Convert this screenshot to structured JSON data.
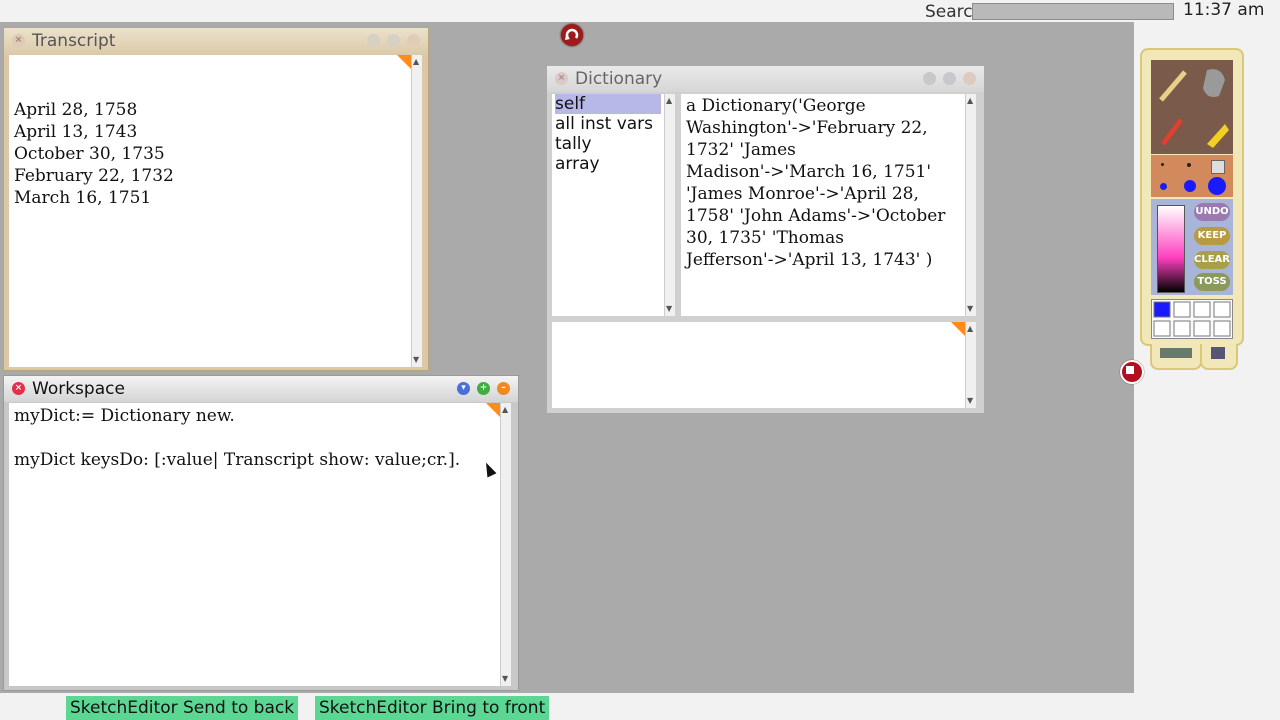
{
  "topbar": {
    "search_label": "Searc",
    "clock": "11:37 am"
  },
  "transcript": {
    "title": "Transcript",
    "lines": [
      "April 28, 1758",
      "April 13, 1743",
      "October 30, 1735",
      "February 22, 1732",
      "March 16, 1751"
    ]
  },
  "workspace": {
    "title": "Workspace",
    "lines": [
      "myDict:= Dictionary new.",
      "myDict keysDo: [:value| Transcript show: value;cr.]."
    ]
  },
  "dictionary": {
    "title": "Dictionary",
    "fields": [
      "self",
      "all inst vars",
      "tally",
      "array"
    ],
    "selected_field": "self",
    "value_lines": [
      "a Dictionary('George",
      "Washington'->'February 22,",
      "1732' 'James",
      "Madison'->'March 16, 1751'",
      "'James Monroe'->'April 28,",
      "1758' 'John Adams'->'October",
      "30, 1735' 'Thomas",
      "Jefferson'->'April 13, 1743' )"
    ]
  },
  "paint_tool": {
    "buttons": [
      "UNDO",
      "KEEP",
      "CLEAR",
      "TOSS"
    ],
    "selected_color": "#1a1aff"
  },
  "bottom_buttons": [
    "SketchEditor Send to back",
    "SketchEditor Bring to front"
  ],
  "colors": {
    "transcript_frame": "#dcc8a6",
    "accent_orange": "#ff8c1a",
    "bottom_button": "#5cd693"
  }
}
